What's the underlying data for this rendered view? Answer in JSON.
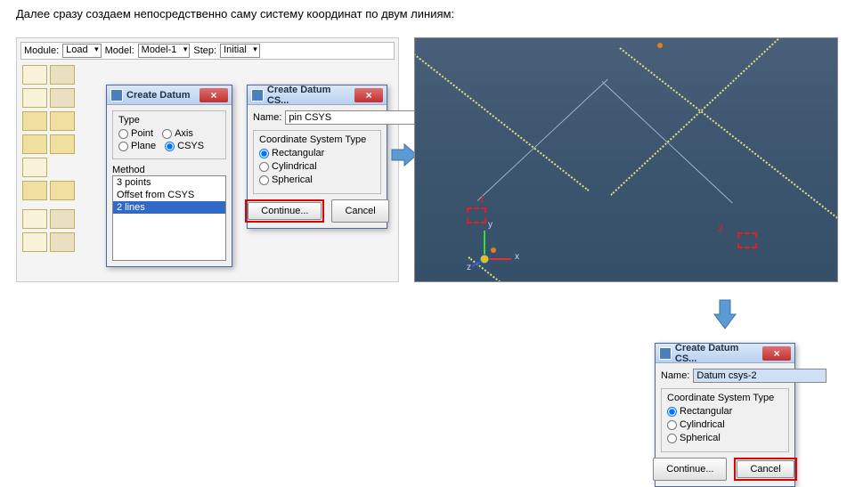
{
  "heading": "Далее сразу создаем непосредственно саму систему координат по двум линиям:",
  "toolbar": {
    "module_label": "Module:",
    "module_value": "Load",
    "model_label": "Model:",
    "model_value": "Model-1",
    "step_label": "Step:",
    "step_value": "Initial"
  },
  "dlg_datum": {
    "title": "Create Datum",
    "type_label": "Type",
    "types": [
      "Point",
      "Axis",
      "Plane",
      "CSYS"
    ],
    "type_selected": "CSYS",
    "method_label": "Method",
    "methods": [
      "3 points",
      "Offset from CSYS",
      "2 lines"
    ],
    "method_selected": "2 lines"
  },
  "dlg_csys": {
    "title": "Create Datum CS...",
    "name_label": "Name:",
    "name_value": "pin CSYS",
    "group_label": "Coordinate System Type",
    "options": [
      "Rectangular",
      "Cylindrical",
      "Spherical"
    ],
    "selected": "Rectangular",
    "continue": "Continue...",
    "cancel": "Cancel"
  },
  "dlg_csys2": {
    "title": "Create Datum CS...",
    "name_label": "Name:",
    "name_value": "Datum csys-2",
    "group_label": "Coordinate System Type",
    "options": [
      "Rectangular",
      "Cylindrical",
      "Spherical"
    ],
    "selected": "Rectangular",
    "continue": "Continue...",
    "cancel": "Cancel"
  },
  "viewport": {
    "marker1": "1",
    "marker2": "2",
    "axis_x": "x",
    "axis_y": "y",
    "axis_z": "z"
  }
}
